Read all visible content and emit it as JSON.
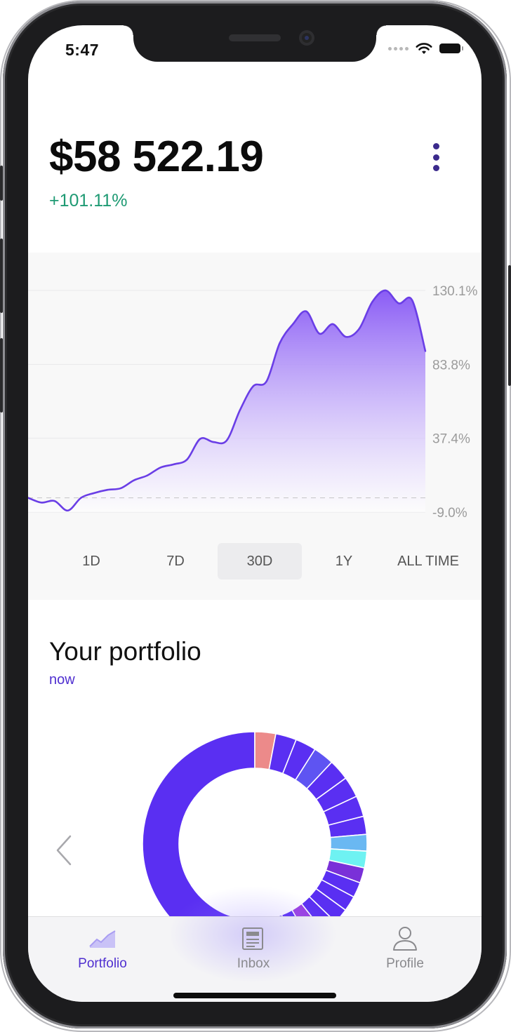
{
  "status_bar": {
    "time": "5:47"
  },
  "header": {
    "balance": "$58 522.19",
    "change": "+101.11%",
    "change_color": "#1e9a73",
    "menu_icon": "more-vertical-icon"
  },
  "chart_data": {
    "type": "area",
    "x": [
      0,
      1,
      2,
      3,
      4,
      5,
      6,
      7,
      8,
      9,
      10,
      11,
      12,
      13,
      14,
      15,
      16,
      17,
      18,
      19,
      20,
      21,
      22,
      23,
      24,
      25,
      26,
      27,
      28,
      29,
      30
    ],
    "values": [
      0,
      -3,
      -2,
      -8,
      0,
      3,
      5,
      6,
      11,
      14,
      19,
      21,
      24,
      37,
      35,
      36,
      55,
      70,
      73,
      97,
      109,
      117,
      103,
      109,
      101,
      106,
      123,
      130.1,
      122,
      124,
      92
    ],
    "y_ticks": [
      "130.1%",
      "83.8%",
      "37.4%",
      "-9.0%"
    ],
    "ylim": [
      -9.0,
      130.1
    ],
    "baseline": 0,
    "grid": true,
    "series_color": "#7a4df0"
  },
  "ranges": [
    {
      "label": "1D",
      "active": false
    },
    {
      "label": "7D",
      "active": false
    },
    {
      "label": "30D",
      "active": true
    },
    {
      "label": "1Y",
      "active": false
    },
    {
      "label": "ALL TIME",
      "active": false
    }
  ],
  "portfolio": {
    "title": "Your portfolio",
    "subtitle": "now",
    "prev_icon": "chevron-left-icon",
    "donut_segments": [
      {
        "color": "#5a2ff2",
        "share": 53.3
      },
      {
        "color": "#ec8a8a",
        "share": 3.0
      },
      {
        "color": "#5a2ff2",
        "share": 3.0
      },
      {
        "color": "#5a2ff2",
        "share": 3.0
      },
      {
        "color": "#5e54f2",
        "share": 3.0
      },
      {
        "color": "#5a2ff2",
        "share": 3.0
      },
      {
        "color": "#5a2ff2",
        "share": 3.0
      },
      {
        "color": "#5a2ff2",
        "share": 3.0
      },
      {
        "color": "#5a2ff2",
        "share": 2.6
      },
      {
        "color": "#6ab8f2",
        "share": 2.4
      },
      {
        "color": "#6ef2f2",
        "share": 2.4
      },
      {
        "color": "#7a30d8",
        "share": 2.2
      },
      {
        "color": "#5a2ff2",
        "share": 2.2
      },
      {
        "color": "#5a2ff2",
        "share": 2.2
      },
      {
        "color": "#5a2ff2",
        "share": 2.2
      },
      {
        "color": "#5a2ff2",
        "share": 2.2
      },
      {
        "color": "#9a3ee0",
        "share": 2.4
      },
      {
        "color": "#5a2ff2",
        "share": 2.4
      },
      {
        "color": "#5a2ff2",
        "share": 2.4
      }
    ]
  },
  "tabbar": {
    "items": [
      {
        "label": "Portfolio",
        "icon": "chart-icon",
        "active": true
      },
      {
        "label": "Inbox",
        "icon": "newspaper-icon",
        "active": false
      },
      {
        "label": "Profile",
        "icon": "person-icon",
        "active": false
      }
    ],
    "active_color": "#4f2fd0",
    "inactive_color": "#8a8a8e"
  }
}
